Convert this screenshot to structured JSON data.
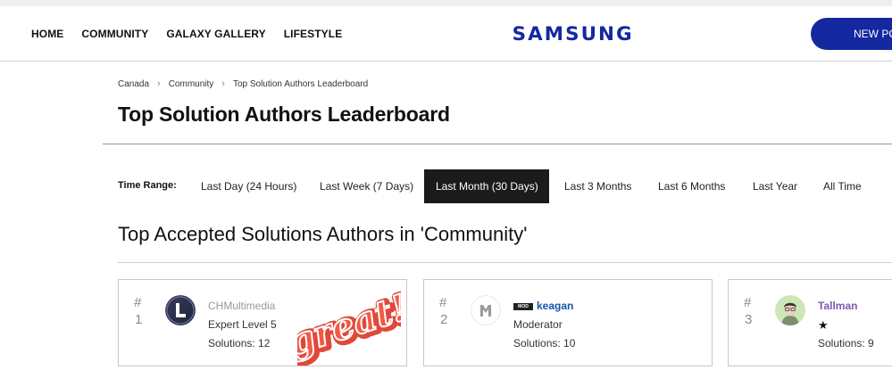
{
  "header": {
    "nav": [
      "HOME",
      "COMMUNITY",
      "GALAXY GALLERY",
      "LIFESTYLE"
    ],
    "logo": "SAMSUNG",
    "new_post_label": "NEW PO"
  },
  "breadcrumb": [
    "Canada",
    "Community",
    "Top Solution Authors Leaderboard"
  ],
  "page_title": "Top Solution Authors Leaderboard",
  "time_range": {
    "label": "Time Range:",
    "options": [
      "Last Day (24 Hours)",
      "Last Week (7 Days)",
      "Last Month (30 Days)",
      "Last 3 Months",
      "Last 6 Months",
      "Last Year",
      "All Time"
    ],
    "selected": "Last Month (30 Days)"
  },
  "section_title": "Top Accepted Solutions Authors in 'Community'",
  "authors": [
    {
      "hash": "#",
      "rank": "1",
      "name": "CHMultimedia",
      "rank_title": "Expert Level 5",
      "solutions": "Solutions: 12",
      "sticker_text": "great!"
    },
    {
      "hash": "#",
      "rank": "2",
      "name": "keagan",
      "badge": "MOD",
      "rank_title": "Moderator",
      "solutions": "Solutions: 10"
    },
    {
      "hash": "#",
      "rank": "3",
      "name": "Tallman",
      "rank_title": "★",
      "solutions": "Solutions: 9"
    }
  ],
  "colors": {
    "brand_blue": "#1428a0",
    "active_tab": "#1b1b1b",
    "link_blue": "#1256a8",
    "purple_name": "#7d58b0"
  }
}
